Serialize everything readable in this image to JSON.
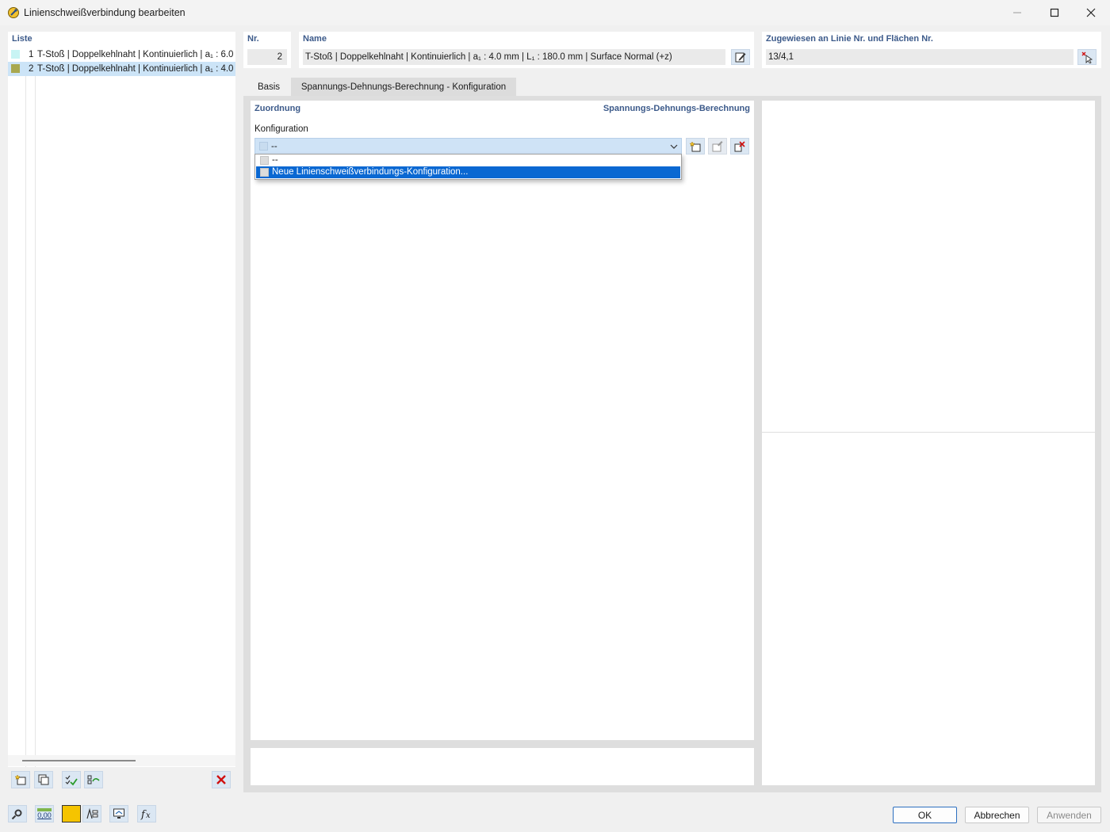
{
  "window": {
    "title": "Linienschweißverbindung bearbeiten"
  },
  "list": {
    "label": "Liste",
    "items": [
      {
        "num": "1",
        "text": "T-Stoß | Doppelkehlnaht | Kontinuierlich | a₁ : 6.0",
        "color": "#c8f4f4",
        "selected": false
      },
      {
        "num": "2",
        "text": "T-Stoß | Doppelkehlnaht | Kontinuierlich | a₁ : 4.0",
        "color": "#a8a850",
        "selected": true
      }
    ]
  },
  "header": {
    "nr_label": "Nr.",
    "nr_value": "2",
    "name_label": "Name",
    "name_value": "T-Stoß | Doppelkehlnaht | Kontinuierlich | a₁ : 4.0 mm | L₁ : 180.0 mm | Surface Normal (+z)",
    "assigned_label": "Zugewiesen an Linie Nr. und Flächen Nr.",
    "assigned_value": "13/4,1"
  },
  "tabs": [
    {
      "label": "Basis",
      "active": false
    },
    {
      "label": "Spannungs-Dehnungs-Berechnung - Konfiguration",
      "active": true
    }
  ],
  "main": {
    "section_left": "Zuordnung",
    "section_right": "Spannungs-Dehnungs-Berechnung",
    "config_label": "Konfiguration",
    "combo_value": "--",
    "dropdown_options": [
      {
        "label": "--",
        "highlighted": false
      },
      {
        "label": "Neue Linienschweißverbindungs-Konfiguration...",
        "highlighted": true
      }
    ]
  },
  "buttons": {
    "ok": "OK",
    "cancel": "Abbrechen",
    "apply": "Anwenden"
  },
  "status_values": {
    "decimals_icon_text": "0,00"
  },
  "colors": {
    "accent": "#3c5a8a",
    "selection": "#cce4f7",
    "highlight": "#0a68d2",
    "yellow_swatch": "#f5c400",
    "delete_red": "#d01010"
  }
}
